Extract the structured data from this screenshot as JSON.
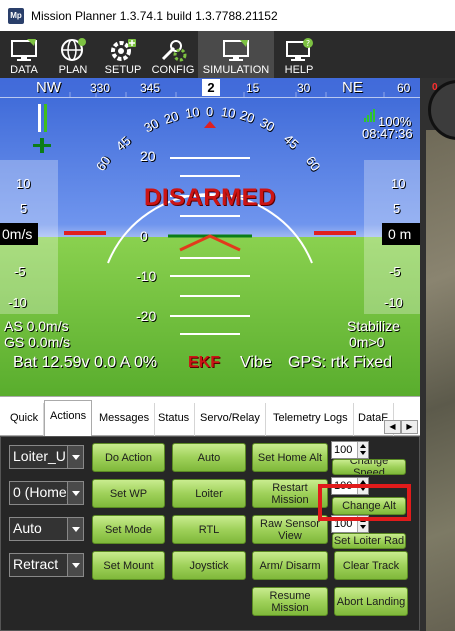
{
  "window": {
    "title": "Mission Planner 1.3.74.1 build 1.3.7788.21152",
    "app_icon_text": "Mp"
  },
  "toolbar": {
    "items": [
      {
        "label": "DATA",
        "icon": "monitor-data-icon"
      },
      {
        "label": "PLAN",
        "icon": "globe-plan-icon"
      },
      {
        "label": "SETUP",
        "icon": "gear-plus-icon"
      },
      {
        "label": "CONFIG",
        "icon": "wrench-gear-icon"
      },
      {
        "label": "SIMULATION",
        "icon": "monitor-sim-icon"
      },
      {
        "label": "HELP",
        "icon": "help-monitor-icon"
      }
    ],
    "active": "SIMULATION"
  },
  "hud": {
    "heading_labels": [
      "NW",
      "330",
      "345",
      "15",
      "30",
      "NE",
      "60"
    ],
    "heading_value": "2",
    "pitch_labels": [
      "20",
      "10",
      "0",
      "-10",
      "-20"
    ],
    "roll_labels": [
      "60",
      "45",
      "30",
      "20",
      "10",
      "0",
      "10",
      "20",
      "30",
      "45",
      "60"
    ],
    "speed_ticks": [
      "10",
      "5",
      "-5",
      "-10"
    ],
    "speed_value": "0m/s",
    "alt_ticks": [
      "10",
      "5",
      "-5",
      "-10"
    ],
    "alt_value": "0 m",
    "status": "DISARMED",
    "battery_remaining": "100%",
    "time": "08:47:36",
    "airspeed": "AS 0.0m/s",
    "groundspeed": "GS 0.0m/s",
    "mode": "Stabilize",
    "wp_dist": "0m>0",
    "battery": "Bat 12.59v 0.0 A 0%",
    "ekf": "EKF",
    "vibe": "Vibe",
    "gps": "GPS: rtk Fixed",
    "map_zero": "0"
  },
  "tabs": {
    "items": [
      "Quick",
      "Actions",
      "Messages",
      "Status",
      "Servo/Relay",
      "Telemetry Logs",
      "DataF"
    ],
    "active": "Actions"
  },
  "actions": {
    "combos": [
      "Loiter_U",
      "0 (Home)",
      "Auto",
      "Retract"
    ],
    "buttons": {
      "do_action": "Do Action",
      "auto": "Auto",
      "set_home_alt": "Set Home Alt",
      "set_wp": "Set WP",
      "loiter": "Loiter",
      "restart_mission": "Restart Mission",
      "set_mode": "Set Mode",
      "rtl": "RTL",
      "raw_sensor_view": "Raw Sensor View",
      "set_mount": "Set Mount",
      "joystick": "Joystick",
      "arm_disarm": "Arm/ Disarm",
      "clear_track": "Clear Track",
      "resume_mission": "Resume Mission",
      "abort_landing": "Abort Landing",
      "change_speed": "Change Speed",
      "change_alt": "Change Alt",
      "set_loiter_rad": "Set Loiter Rad"
    },
    "nums": [
      "100",
      "100",
      "100"
    ]
  }
}
